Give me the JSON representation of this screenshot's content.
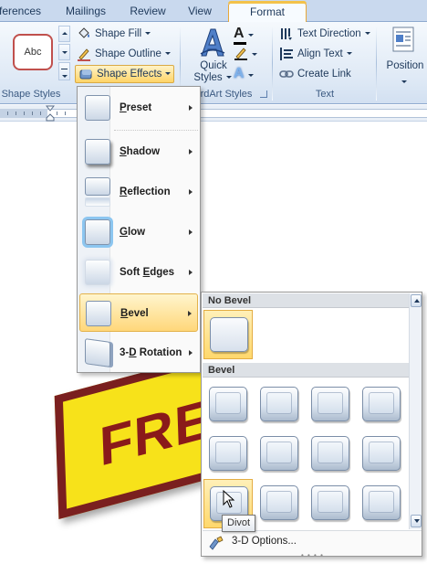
{
  "tabs": [
    "ferences",
    "Mailings",
    "Review",
    "View",
    "Format"
  ],
  "ribbon": {
    "shape_styles": {
      "thumb_label": "Abc",
      "shape_fill": "Shape Fill",
      "shape_outline": "Shape Outline",
      "shape_effects": "Shape Effects",
      "group_label": "Shape Styles"
    },
    "wordart": {
      "quick_styles_line1": "Quick",
      "quick_styles_line2": "Styles",
      "group_label": "rdArt Styles"
    },
    "text_group": {
      "text_direction": "Text Direction",
      "align_text": "Align Text",
      "create_link": "Create Link",
      "group_label": "Text"
    },
    "arrange": {
      "position": "Position"
    }
  },
  "effects_menu": {
    "items": [
      {
        "label": "Preset",
        "accel": "P",
        "rest": "reset"
      },
      {
        "label": "Shadow",
        "accel": "S",
        "rest": "hadow"
      },
      {
        "label": "Reflection",
        "accel": "R",
        "rest": "eflection"
      },
      {
        "label": "Glow",
        "accel": "G",
        "rest": "low"
      },
      {
        "label": "Soft Edges",
        "pre": "Soft ",
        "accel": "E",
        "rest": "dges"
      },
      {
        "label": "Bevel",
        "accel": "B",
        "rest": "evel"
      },
      {
        "label": "3-D Rotation",
        "pre": "3-",
        "accel": "D",
        "rest": " Rotation"
      }
    ]
  },
  "bevel_gallery": {
    "no_bevel_header": "No Bevel",
    "bevel_header": "Bevel",
    "footer_option": "3-D Options...",
    "tooltip": "Divot"
  },
  "document": {
    "sign_text": "FREE"
  },
  "colors": {
    "tab_active_border": "#e8a838",
    "highlight": "#ffd77a",
    "sign_fill": "#f7e21a",
    "sign_border": "#7a1f1f",
    "sign_text": "#8a1a1a"
  }
}
